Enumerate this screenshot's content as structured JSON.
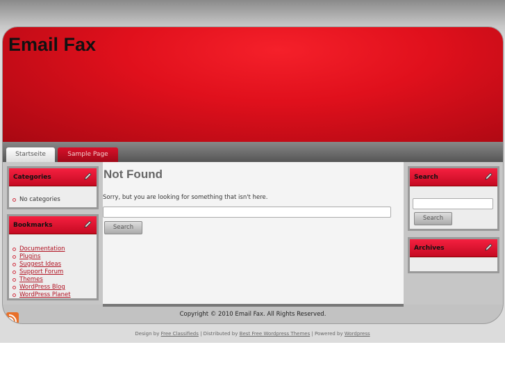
{
  "site_title": "Email Fax",
  "nav": {
    "tabs": [
      "Startseite",
      "Sample Page"
    ]
  },
  "sidebar_left": {
    "categories": {
      "title": "Categories",
      "items": [
        "No categories"
      ]
    },
    "bookmarks": {
      "title": "Bookmarks",
      "items": [
        "Documentation",
        "Plugins",
        "Suggest Ideas",
        "Support Forum",
        "Themes",
        "WordPress Blog",
        "WordPress Planet"
      ]
    }
  },
  "main": {
    "title": "Not Found",
    "message": "Sorry, but you are looking for something that isn't here.",
    "search_value": "",
    "search_button": "Search"
  },
  "sidebar_right": {
    "search": {
      "title": "Search",
      "search_value": "",
      "button": "Search"
    },
    "archives": {
      "title": "Archives"
    }
  },
  "footer": {
    "copyright": "Copyright © 2010 Email Fax. All Rights Reserved."
  },
  "credits": {
    "design_by": "Design by",
    "link1": "Free Classifieds",
    "distributed_by": "| Distributed by",
    "link2": "Best Free Wordpress Themes",
    "powered_by": "| Powered by",
    "link3": "Wordpress"
  }
}
